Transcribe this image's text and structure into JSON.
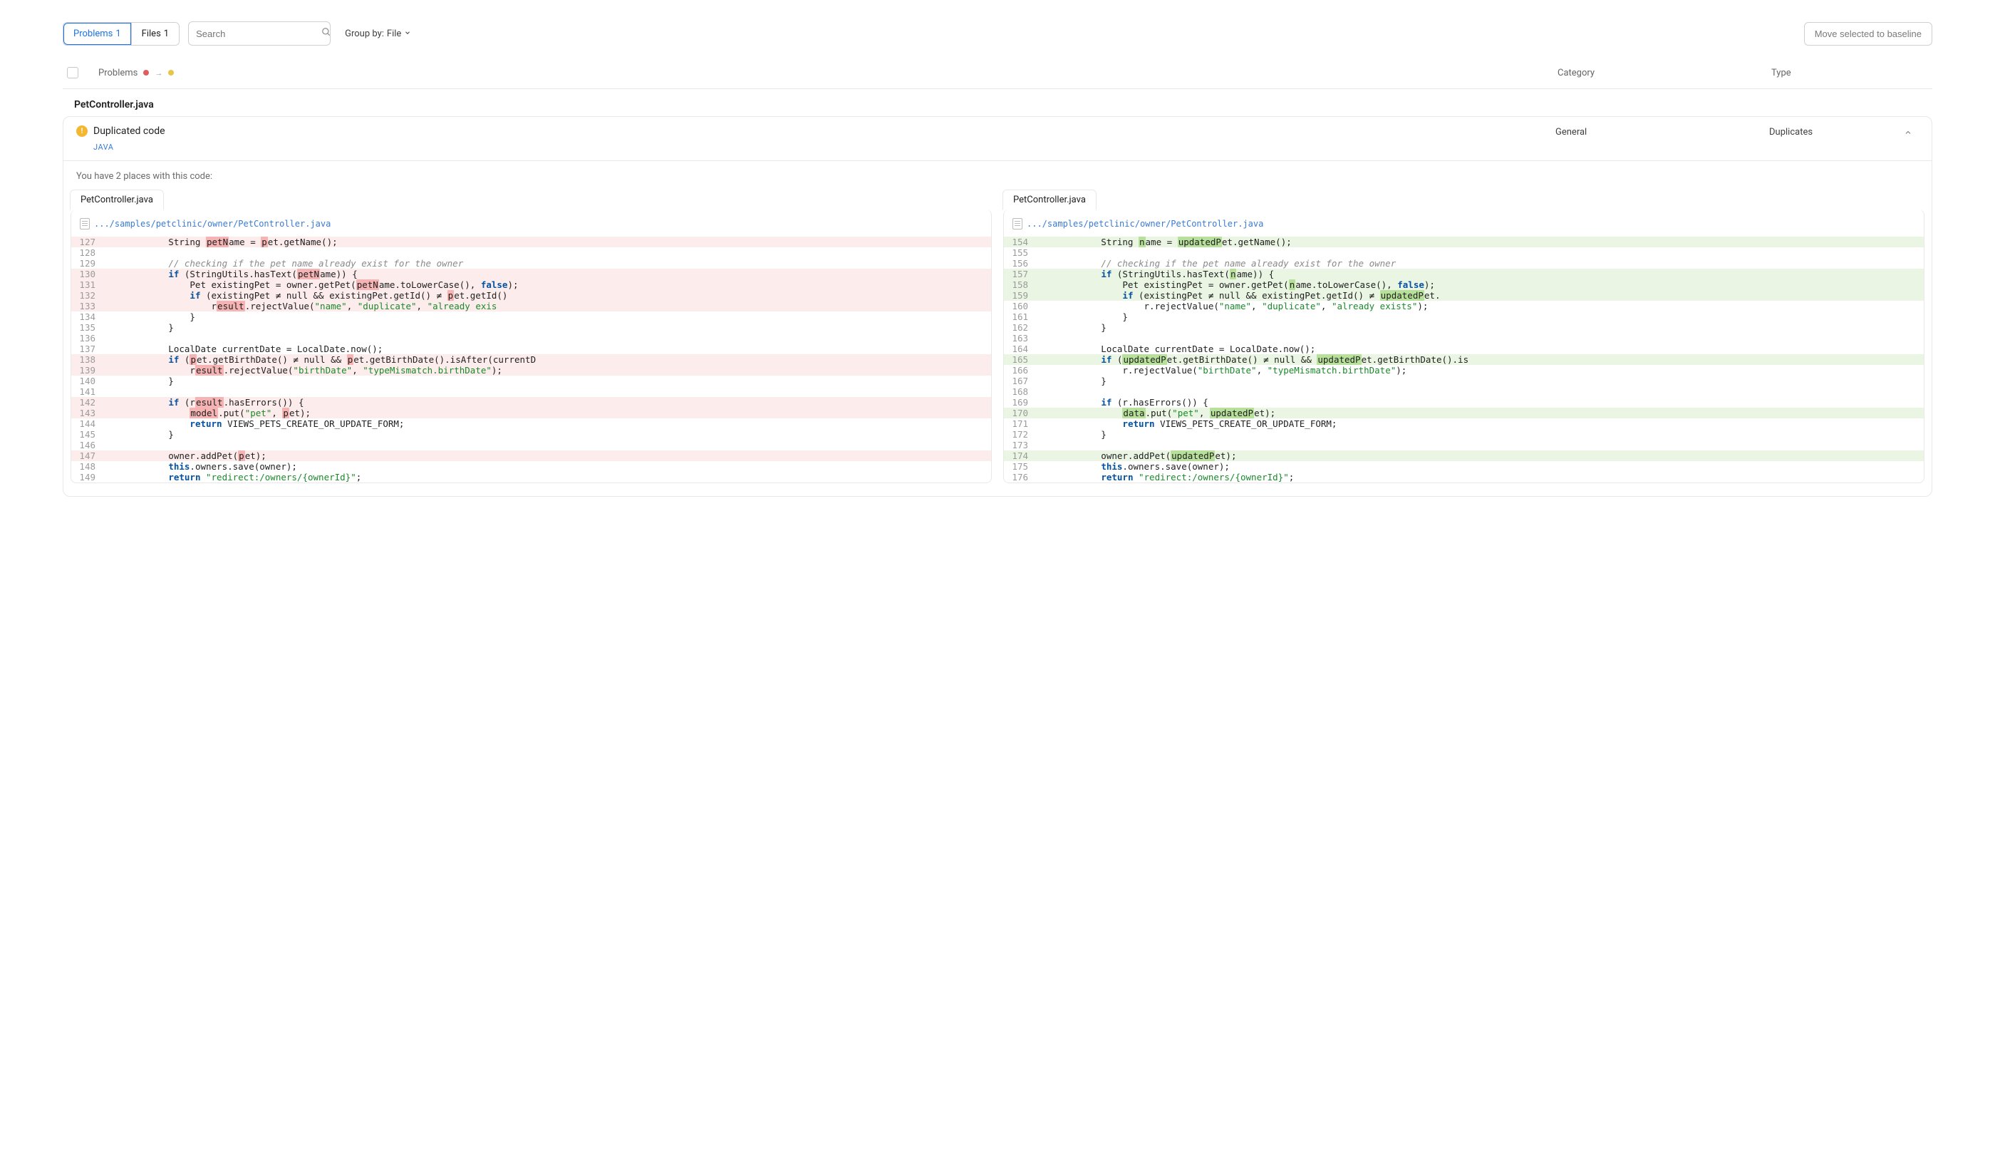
{
  "toolbar": {
    "tab_problems": "Problems",
    "tab_problems_count": "1",
    "tab_files": "Files",
    "tab_files_count": "1",
    "search_placeholder": "Search",
    "group_by_label": "Group by:",
    "group_by_value": "File",
    "baseline_btn": "Move selected to baseline"
  },
  "headers": {
    "problems": "Problems",
    "category": "Category",
    "type": "Type"
  },
  "file": {
    "name": "PetController.java"
  },
  "issue": {
    "title": "Duplicated code",
    "lang_tag": "JAVA",
    "category": "General",
    "type": "Duplicates",
    "body_msg": "You have 2 places with this code:"
  },
  "panes": {
    "left": {
      "tab": "PetController.java",
      "path": ".../samples/petclinic/owner/PetController.java",
      "start": 127
    },
    "right": {
      "tab": "PetController.java",
      "path": ".../samples/petclinic/owner/PetController.java",
      "start": 154
    }
  }
}
